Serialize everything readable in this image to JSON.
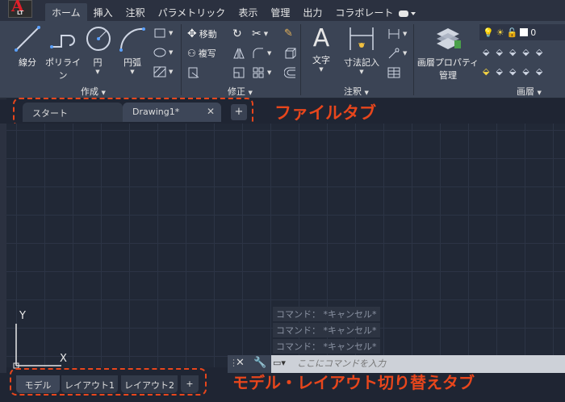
{
  "app": {
    "logo_letter": "A",
    "edition": "LT"
  },
  "ribbon_tabs": [
    "ホーム",
    "挿入",
    "注釈",
    "パラメトリック",
    "表示",
    "管理",
    "出力",
    "コラボレート"
  ],
  "ribbon": {
    "draw": {
      "line": "線分",
      "polyline": "ポリライン",
      "circle": "円",
      "arc": "円弧",
      "panel": "作成"
    },
    "modify": {
      "move": "移動",
      "copy": "複写",
      "panel": "修正"
    },
    "annotation": {
      "text": "文字",
      "dimension": "寸法記入",
      "panel": "注釈"
    },
    "layers": {
      "properties_line1": "画層プロパティ",
      "properties_line2": "管理",
      "panel": "画層",
      "current_layer": "0"
    }
  },
  "file_tabs": {
    "start": "スタート",
    "drawing": "Drawing1*",
    "close": "✕",
    "add": "+"
  },
  "annotations": {
    "file_tabs": "ファイルタブ",
    "layout_tabs": "モデル・レイアウト切り替えタブ"
  },
  "ucs": {
    "y": "Y",
    "x": "X"
  },
  "command": {
    "history": [
      "コマンド： *キャンセル*",
      "コマンド： *キャンセル*",
      "コマンド： *キャンセル*"
    ],
    "placeholder": "ここにコマンドを入力"
  },
  "layout_tabs": [
    "モデル",
    "レイアウト1",
    "レイアウト2"
  ],
  "layout_add": "+",
  "colors": {
    "accent_annotation": "#e8461c",
    "canvas": "#212836",
    "ribbon": "#3b4455"
  }
}
